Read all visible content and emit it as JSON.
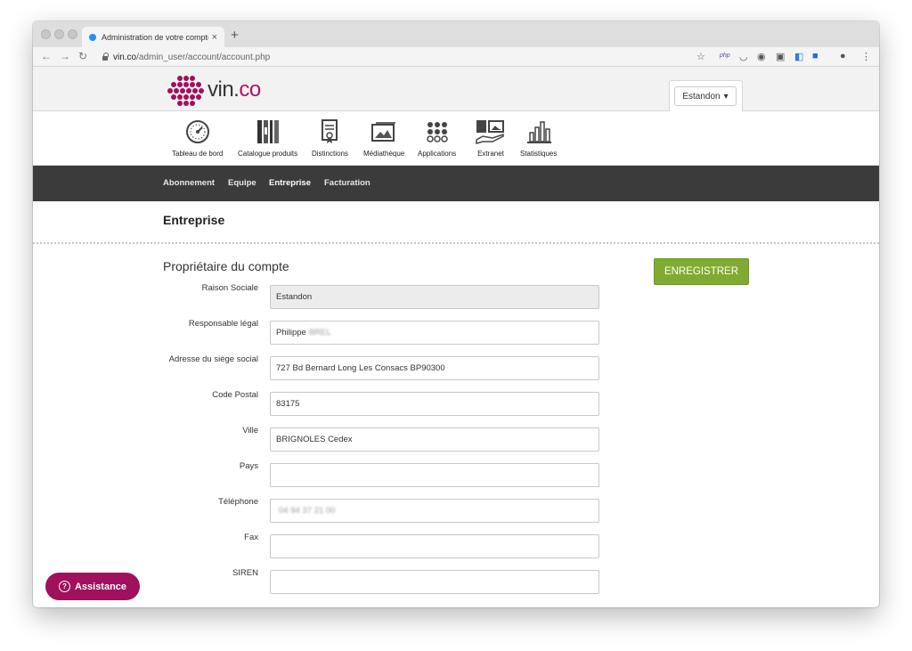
{
  "browser": {
    "tab_title": "Administration de votre compte",
    "tab_close": "×",
    "new_tab": "+",
    "url_host": "vin.co",
    "url_path": "/admin_user/account/account.php",
    "ext_php": "php"
  },
  "header": {
    "logo_vin": "vin.",
    "logo_co": "co",
    "account_label": "Estandon",
    "account_caret": "▾"
  },
  "modules": [
    {
      "label": "Tableau de bord",
      "icon": "dashboard-icon"
    },
    {
      "label": "Catalogue produits",
      "icon": "catalogue-icon"
    },
    {
      "label": "Distinctions",
      "icon": "distinction-icon"
    },
    {
      "label": "Médiathèque",
      "icon": "image-library-icon"
    },
    {
      "label": "Applications",
      "icon": "apps-grid-icon"
    },
    {
      "label": "Extranet",
      "icon": "extranet-icon"
    },
    {
      "label": "Statistiques",
      "icon": "stats-icon"
    }
  ],
  "subnav": [
    {
      "label": "Abonnement",
      "active": false
    },
    {
      "label": "Equipe",
      "active": false
    },
    {
      "label": "Entreprise",
      "active": true
    },
    {
      "label": "Facturation",
      "active": false
    }
  ],
  "page": {
    "title": "Entreprise",
    "section_title": "Propriétaire du compte",
    "save_label": "ENREGISTRER"
  },
  "form": [
    {
      "label": "Raison Sociale",
      "value": "Estandon",
      "disabled": true
    },
    {
      "label": "Responsable légal",
      "value": "Philippe",
      "blurred": "BREL"
    },
    {
      "label": "Adresse du siège social",
      "value": "727 Bd Bernard Long Les Consacs BP90300"
    },
    {
      "label": "Code Postal",
      "value": "83175"
    },
    {
      "label": "Ville",
      "value": "BRIGNOLES Cedex"
    },
    {
      "label": "Pays",
      "value": ""
    },
    {
      "label": "Téléphone",
      "value": "",
      "blurred": "04 94 37 21 00"
    },
    {
      "label": "Fax",
      "value": ""
    },
    {
      "label": "SIREN",
      "value": ""
    }
  ],
  "assistance": {
    "label": "Assistance",
    "icon_glyph": "?"
  },
  "colors": {
    "brand": "#a1105c",
    "save": "#7fac30",
    "subnav_bg": "#3b3b3b"
  }
}
